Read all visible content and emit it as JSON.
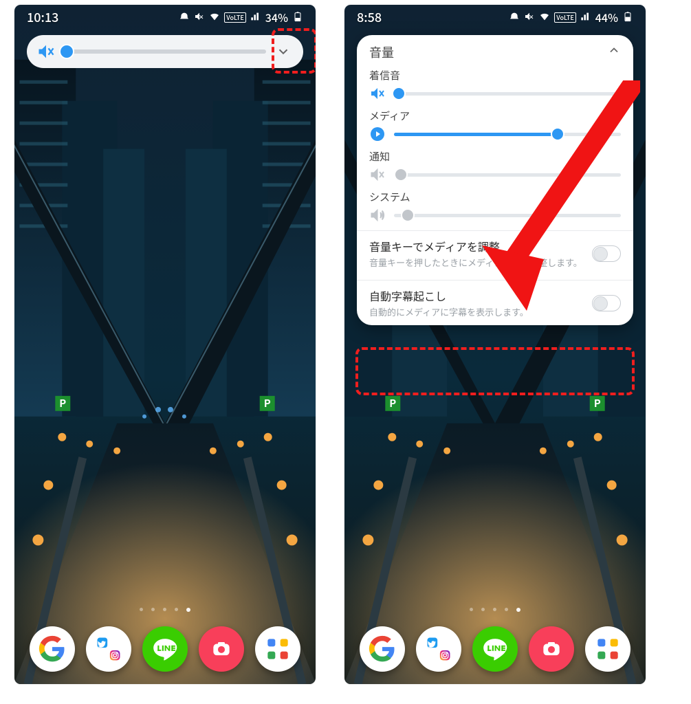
{
  "left": {
    "status": {
      "time": "10:13",
      "battery": "34%"
    },
    "volume_hud": {
      "value_pct": 2
    }
  },
  "right": {
    "status": {
      "time": "8:58",
      "battery": "44%"
    },
    "panel": {
      "title": "音量",
      "sliders": {
        "ringtone": {
          "label": "着信音",
          "value_pct": 2,
          "active": true,
          "icon": "mute"
        },
        "media": {
          "label": "メディア",
          "value_pct": 72,
          "active": true,
          "icon": "play"
        },
        "notif": {
          "label": "通知",
          "value_pct": 3,
          "active": false,
          "icon": "mute"
        },
        "system": {
          "label": "システム",
          "value_pct": 6,
          "active": false,
          "icon": "spk"
        }
      },
      "toggles": {
        "media_key": {
          "title": "音量キーでメディアを調整",
          "desc": "音量キーを押したときにメディア音量を調整します。",
          "on": false
        },
        "captions": {
          "title": "自動字幕起こし",
          "desc": "自動的にメディアに字幕を表示します。",
          "on": false
        }
      }
    }
  },
  "apps": [
    "google",
    "twitter-ig",
    "line",
    "camera",
    "folder"
  ]
}
